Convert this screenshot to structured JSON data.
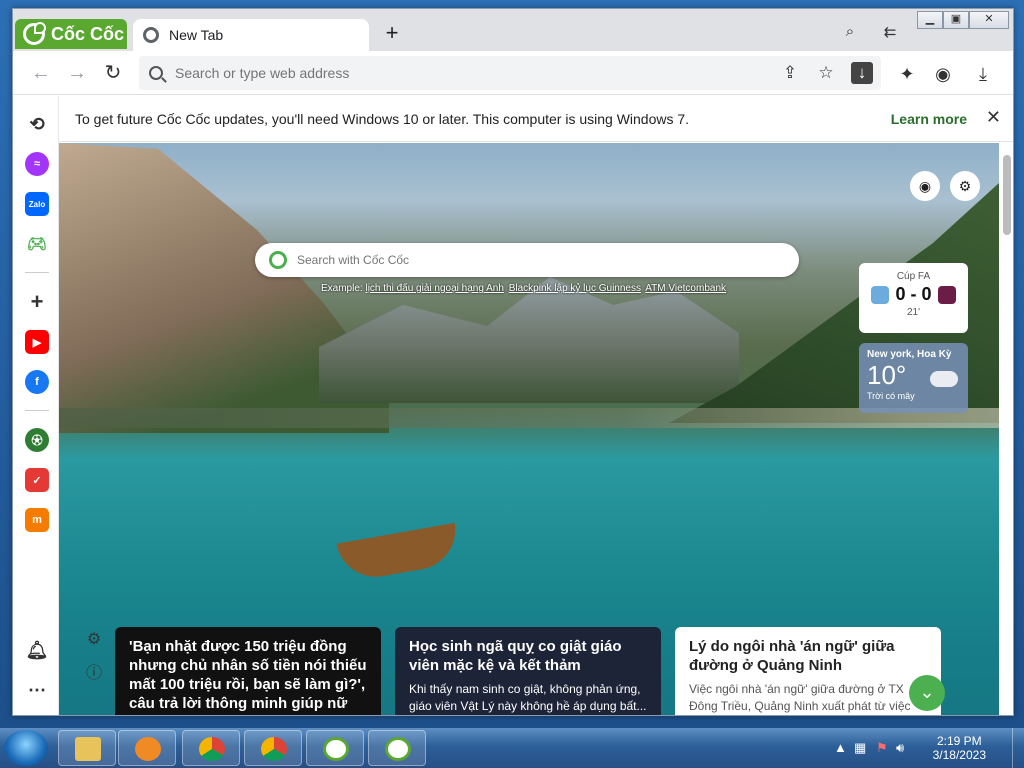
{
  "browser": {
    "brand": "Cốc Cốc",
    "tab": {
      "title": "New Tab"
    },
    "omnibox": {
      "placeholder": "Search or type web address"
    }
  },
  "infobar": {
    "message": "To get future Cốc Cốc updates, you'll need Windows 10 or later. This computer is using Windows 7.",
    "link": "Learn more"
  },
  "sidebar": {
    "items": [
      {
        "name": "history",
        "icon": "history-icon"
      },
      {
        "name": "messenger",
        "icon": "messenger-icon",
        "color": "#a334fa"
      },
      {
        "name": "zalo",
        "icon": "zalo-icon",
        "label": "Zalo",
        "color": "#0068ff"
      },
      {
        "name": "games",
        "icon": "gamepad-icon",
        "color": "#4caf50"
      },
      {
        "name": "add",
        "icon": "plus-icon"
      },
      {
        "name": "youtube",
        "icon": "youtube-icon",
        "color": "#ff0000"
      },
      {
        "name": "facebook",
        "icon": "facebook-icon",
        "color": "#1877f2"
      },
      {
        "name": "football",
        "icon": "football-icon"
      },
      {
        "name": "todo",
        "icon": "checklist-icon",
        "color": "#e53935"
      },
      {
        "name": "shopping",
        "icon": "shopping-icon",
        "color": "#f57c00"
      }
    ]
  },
  "newtab": {
    "search": {
      "placeholder": "Search with Cốc Cốc"
    },
    "examples": {
      "label": "Example:",
      "links": [
        "lịch thi đấu giải ngoại hạng Anh",
        "Blackpink lập kỷ lục Guinness",
        "ATM Vietcombank"
      ]
    },
    "score": {
      "competition": "Cúp FA",
      "score": "0 - 0",
      "minute": "21'"
    },
    "weather": {
      "city": "New york, Hoa Kỳ",
      "temperature": "10°",
      "condition": "Trời có mây"
    },
    "news": [
      {
        "headline": "'Bạn nhặt được 150 triệu đồng nhưng chủ nhân số tiền nói thiếu mất 100 triệu rồi, bạn sẽ làm gì?', câu trả lời thông minh giúp nữ ứng viên được thuê",
        "snippet": ""
      },
      {
        "headline": "Học sinh ngã quỵ co giật giáo viên mặc kệ và kết thảm",
        "snippet": "Khi thấy nam sinh co giật, không phản ứng, giáo viên Vật Lý này không hề áp dụng bất..."
      },
      {
        "headline": "Lý do ngôi nhà 'án ngữ' giữa đường ở Quảng Ninh",
        "snippet": "Việc ngôi nhà 'án ngữ' giữa đường ở TX Đông Triều, Quảng Ninh xuất phát từ việc chưa thống nhất trong phương án bồi"
      }
    ]
  },
  "taskbar": {
    "time": "2:19 PM",
    "date": "3/18/2023",
    "apps": [
      "explorer",
      "media-player",
      "chrome-intel",
      "chrome-intel",
      "coccoc-intel",
      "coccoc-user"
    ]
  }
}
